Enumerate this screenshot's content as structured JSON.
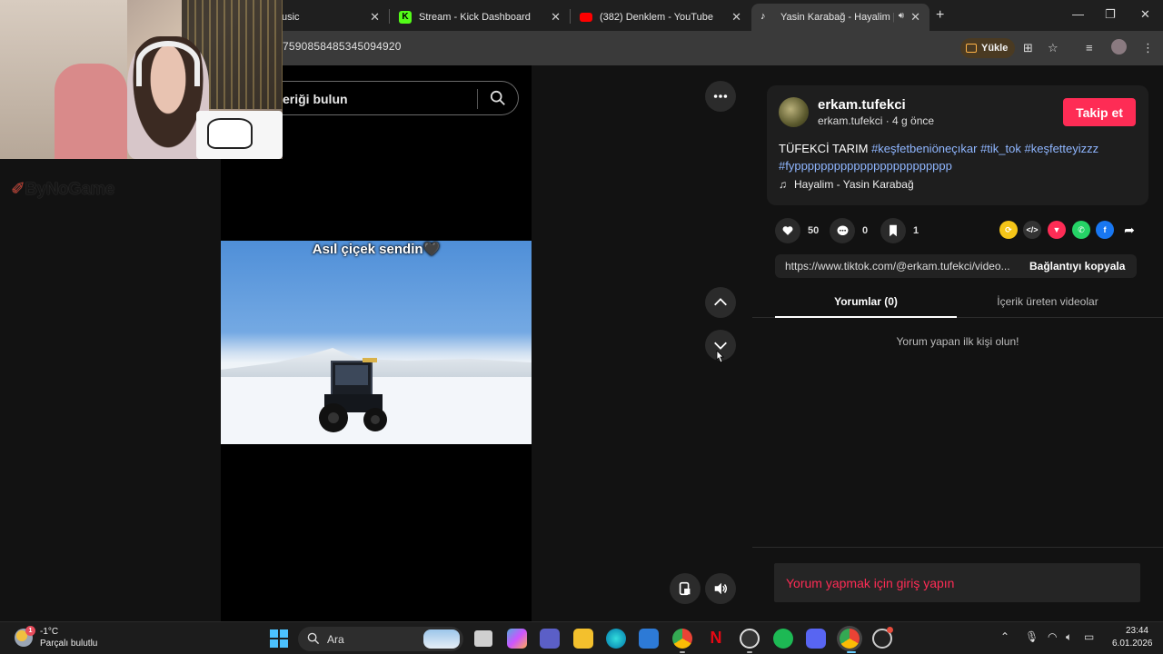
{
  "browser": {
    "tabs": [
      {
        "title": "usic",
        "favicon": "music-favicon",
        "color": "#888888"
      },
      {
        "title": "Stream - Kick Dashboard",
        "favicon": "kick-favicon",
        "color": "#53fc18"
      },
      {
        "title": "(382) Denklem - YouTube",
        "favicon": "youtube-favicon",
        "color": "#ff0000"
      },
      {
        "title": "Yasin Karabağ - Hayalim | Ti",
        "favicon": "tiktok-favicon",
        "color": "#ffffff",
        "active": true
      }
    ],
    "url": "7590858485345094920",
    "upload_label": "Yükle"
  },
  "stream_overlay": {
    "watermark": "ByNoGame"
  },
  "search": {
    "placeholder_visible": "eriği bulun"
  },
  "video": {
    "caption": "Asıl çiçek sendin🖤"
  },
  "post": {
    "username": "erkam.tufekci",
    "sub": "erkam.tufekci · 4 g önce",
    "follow_label": "Takip et",
    "description_text": "TÜFEKCİ TARIM ",
    "hashtags": [
      "#keşfetbeniöneçıkar",
      "#tik_tok",
      "#keşfetteyizzz",
      "#fypppppppppppppppppppppppp"
    ],
    "music": "Hayalim - Yasin Karabağ",
    "likes": "50",
    "comments": "0",
    "saves": "1",
    "link": "https://www.tiktok.com/@erkam.tufekci/video...",
    "copy_link_label": "Bağlantıyı kopyala"
  },
  "comments_tabs": {
    "comments_label": "Yorumlar (0)",
    "creator_videos_label": "İçerik üreten videolar",
    "empty_text": "Yorum yapan ilk kişi olun!",
    "login_prompt": "Yorum yapmak için giriş yapın"
  },
  "taskbar": {
    "weather_temp": "-1°C",
    "weather_desc": "Parçalı bulutlu",
    "weather_badge": "1",
    "search_label": "Ara",
    "time": "23:44",
    "date": "6.01.2026"
  },
  "colors": {
    "accent": "#fe2c55",
    "hashtag": "#8fb6ff"
  }
}
